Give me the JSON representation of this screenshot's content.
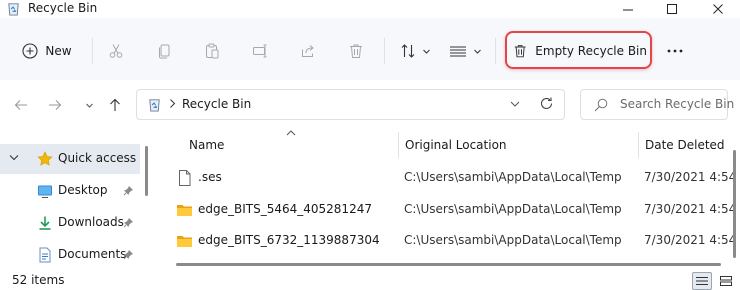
{
  "window": {
    "title": "Recycle Bin"
  },
  "toolbar": {
    "new_label": "New",
    "empty_label": "Empty Recycle Bin",
    "highlight_color": "#e0464c",
    "icons": [
      "cut-icon",
      "copy-icon",
      "paste-icon",
      "rename-icon",
      "share-icon",
      "delete-icon",
      "sort-icon",
      "view-icon",
      "more-icon"
    ]
  },
  "address": {
    "path": "Recycle Bin"
  },
  "search": {
    "placeholder": "Search Recycle Bin"
  },
  "nav": {
    "items": [
      {
        "label": "Quick access",
        "icon": "star-icon"
      },
      {
        "label": "Desktop",
        "icon": "desktop-icon"
      },
      {
        "label": "Downloads",
        "icon": "download-icon"
      },
      {
        "label": "Documents",
        "icon": "document-icon"
      }
    ]
  },
  "columns": {
    "name": "Name",
    "location": "Original Location",
    "date": "Date Deleted"
  },
  "files": [
    {
      "name": ".ses",
      "location": "C:\\Users\\sambi\\AppData\\Local\\Temp",
      "date": "7/30/2021 4:54",
      "icon": "file-icon"
    },
    {
      "name": "edge_BITS_5464_405281247",
      "location": "C:\\Users\\sambi\\AppData\\Local\\Temp",
      "date": "7/30/2021 4:54",
      "icon": "folder-icon"
    },
    {
      "name": "edge_BITS_6732_1139887304",
      "location": "C:\\Users\\sambi\\AppData\\Local\\Temp",
      "date": "7/30/2021 4:54",
      "icon": "folder-icon"
    }
  ],
  "status": {
    "items": "52 items"
  }
}
